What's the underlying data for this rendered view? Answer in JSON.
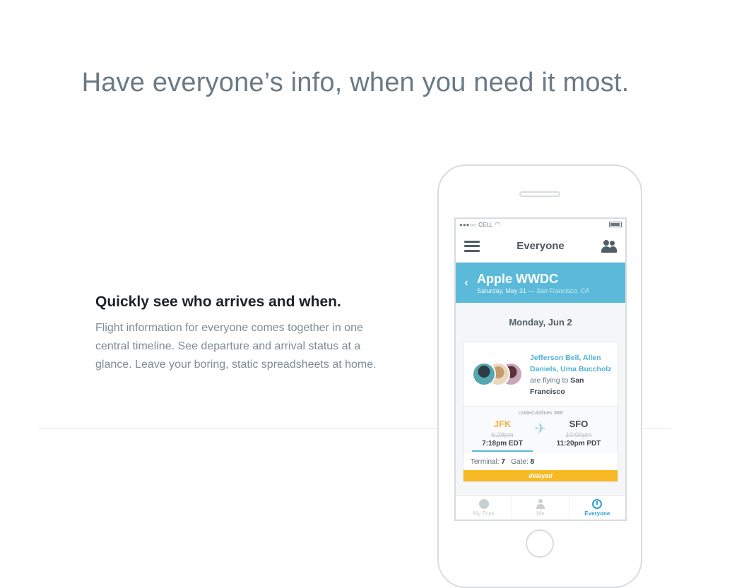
{
  "headline": "Have everyone’s info, when you need it most.",
  "feature": {
    "title": "Quickly see who arrives and when.",
    "body": "Flight information for everyone comes together in one central timeline. See departure and arrival status at a glance. Leave your boring, static spreadsheets at home."
  },
  "colors": {
    "accent": "#5bbad9",
    "active_tab": "#2d9fd2",
    "delayed": "#f7b924"
  },
  "phone": {
    "statusbar": {
      "signal": "●●●○○",
      "carrier": "CELL",
      "wifi_icon": "wifi-icon",
      "battery_icon": "battery-icon"
    },
    "nav": {
      "title": "Everyone",
      "menu_icon": "hamburger-icon",
      "people_icon": "people-icon"
    },
    "event": {
      "title": "Apple WWDC",
      "date": "Saturday, May 31 —",
      "location": "San Francisco, CA"
    },
    "day_header": "Monday, Jun 2",
    "card": {
      "travellers_names": "Jefferson Bell, Allen Daniels, Uma Buccholz",
      "travellers_text": "are flying to",
      "destination": "San Francisco",
      "airline": "United Airlines 389",
      "from": {
        "code": "JFK",
        "scheduled": "6:29pm",
        "actual": "7:18pm EDT"
      },
      "to": {
        "code": "SFO",
        "scheduled": "10:00pm",
        "actual": "11:20pm PDT"
      },
      "terminal_label": "Terminal:",
      "terminal": "7",
      "gate_label": "Gate:",
      "gate": "8",
      "status": "delayed"
    },
    "tabs": [
      {
        "label": "My Trips",
        "icon": "globe-icon"
      },
      {
        "label": "Me",
        "icon": "person-icon"
      },
      {
        "label": "Everyone",
        "icon": "clock-icon",
        "active": true
      }
    ]
  }
}
